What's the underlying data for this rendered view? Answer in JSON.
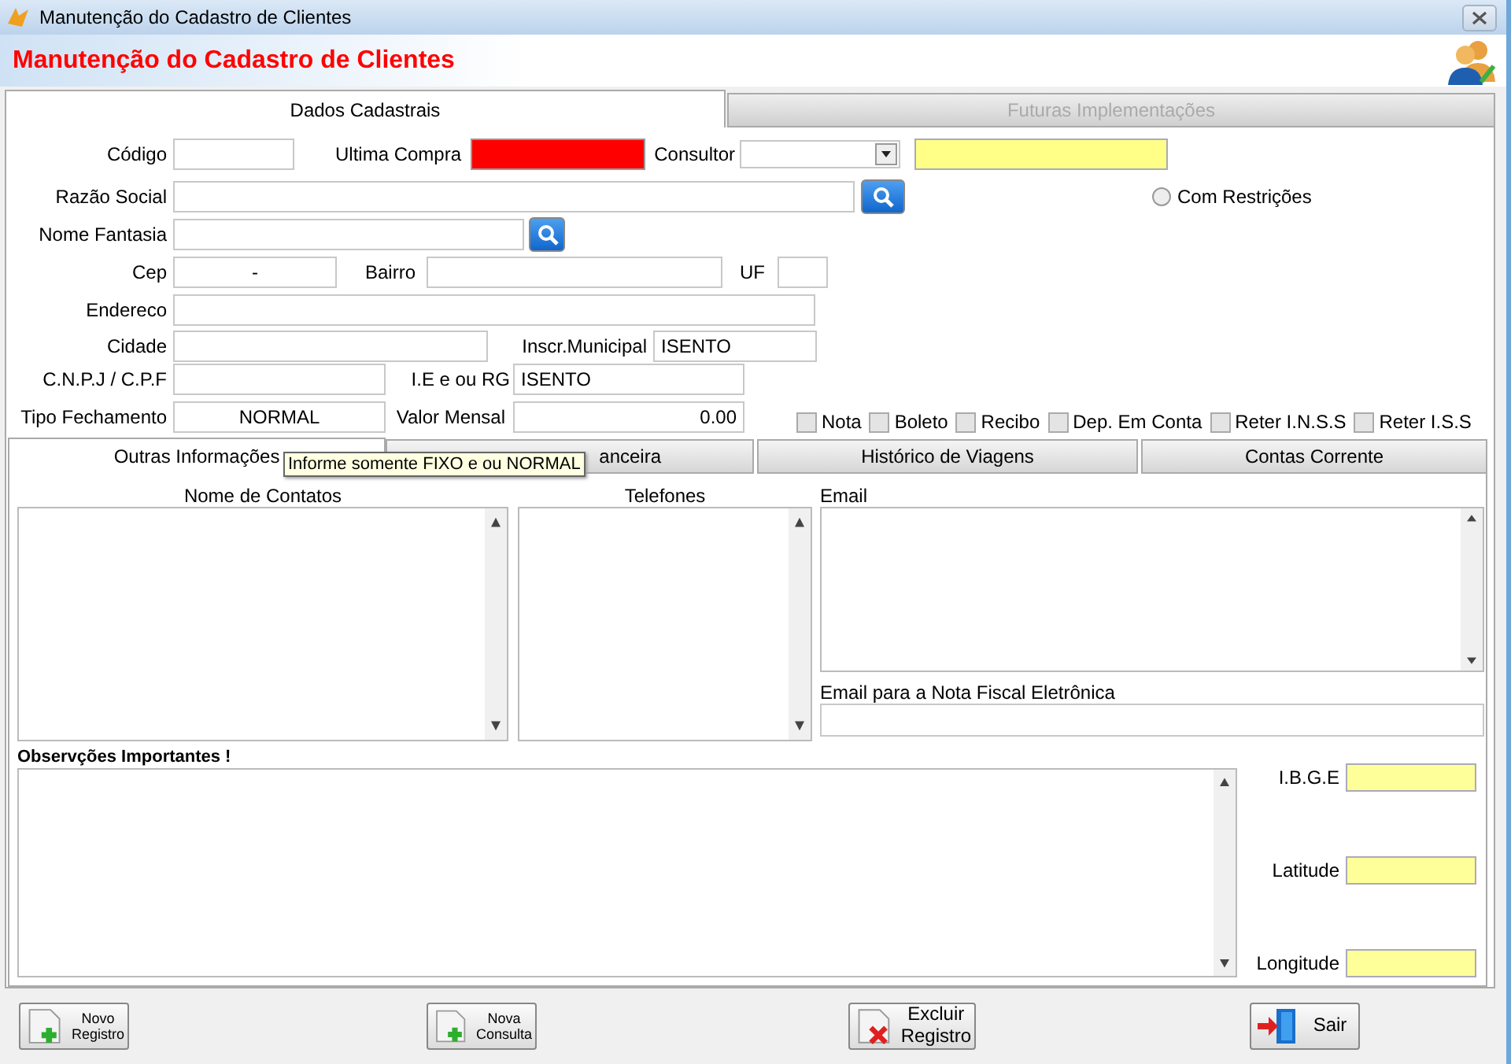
{
  "window": {
    "title": "Manutenção do Cadastro de Clientes"
  },
  "header": {
    "title": "Manutenção do Cadastro de Clientes"
  },
  "tabs": [
    {
      "label": "Dados Cadastrais",
      "selected": true
    },
    {
      "label": "Futuras Implementações",
      "selected": false
    }
  ],
  "form": {
    "codigo": {
      "label": "Código"
    },
    "ultima_compra": {
      "label": "Ultima Compra"
    },
    "consultor": {
      "label": "Consultor"
    },
    "razao_social": {
      "label": "Razão Social"
    },
    "com_restricoes": {
      "label": "Com Restrições",
      "selected": false
    },
    "nome_fantasia": {
      "label": "Nome Fantasia"
    },
    "cep": {
      "label": "Cep",
      "value": "-"
    },
    "bairro": {
      "label": "Bairro"
    },
    "uf": {
      "label": "UF"
    },
    "endereco": {
      "label": "Endereco"
    },
    "cidade": {
      "label": "Cidade"
    },
    "inscr_municipal": {
      "label": "Inscr.Municipal",
      "value": "ISENTO"
    },
    "cnpj_cpf": {
      "label": "C.N.P.J / C.P.F"
    },
    "ie_rg": {
      "label": "I.E e ou RG",
      "value": "ISENTO"
    },
    "tipo_fechamento": {
      "label": "Tipo Fechamento",
      "value": "NORMAL"
    },
    "valor_mensal": {
      "label": "Valor Mensal",
      "value": "0.00"
    }
  },
  "options": [
    {
      "label": "Nota",
      "checked": false
    },
    {
      "label": "Boleto",
      "checked": false
    },
    {
      "label": "Recibo",
      "checked": false
    },
    {
      "label": "Dep. Em Conta",
      "checked": false
    },
    {
      "label": "Reter I.N.S.S",
      "checked": false
    },
    {
      "label": "Reter I.S.S",
      "checked": false
    }
  ],
  "inner_tabs": [
    {
      "label": "Outras Informações",
      "selected": true
    },
    {
      "label": "anceira",
      "selected": false
    },
    {
      "label": "Histórico de Viagens",
      "selected": false
    },
    {
      "label": "Contas Corrente",
      "selected": false
    }
  ],
  "tooltip": {
    "text": "Informe somente FIXO e ou NORMAL"
  },
  "contacts": {
    "names_label": "Nome de Contatos",
    "phones_label": "Telefones",
    "email_label": "Email",
    "nfe_email_label": "Email para a Nota Fiscal Eletrônica"
  },
  "notes": {
    "label": "Observções Importantes !"
  },
  "geo": [
    {
      "label": "I.B.G.E"
    },
    {
      "label": "Latitude"
    },
    {
      "label": "Longitude"
    }
  ],
  "buttons": [
    {
      "label": "Novo Registro",
      "kind": "new"
    },
    {
      "label": "Nova Consulta",
      "kind": "new"
    },
    {
      "label": "Excluir Registro",
      "kind": "delete"
    },
    {
      "label": "Sair",
      "kind": "exit"
    }
  ]
}
